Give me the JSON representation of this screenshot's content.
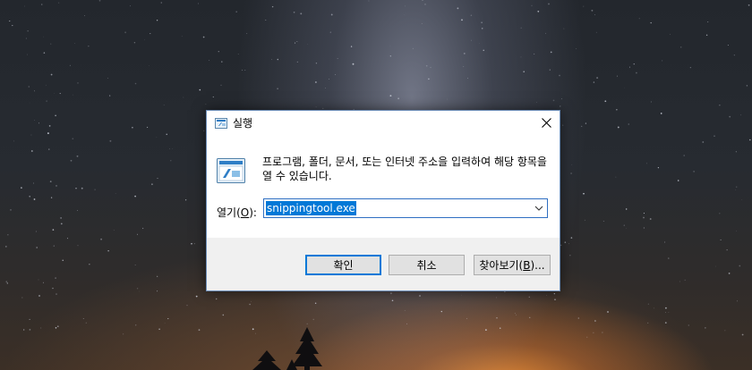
{
  "dialog": {
    "title": "실행",
    "description": "프로그램, 폴더, 문서, 또는 인터넷 주소을 입력하여 해당 항목을 열 수 있습니다.",
    "open_label_prefix": "열기(",
    "open_label_mnemonic": "O",
    "open_label_suffix": "):",
    "command_value": "snippingtool.exe",
    "buttons": {
      "ok": "확인",
      "cancel": "취소",
      "browse_prefix": "찾아보기(",
      "browse_mnemonic": "B",
      "browse_suffix": ")..."
    }
  },
  "colors": {
    "accent": "#0078d7",
    "selection_text": "#ffffff",
    "footer_bg": "#f0f0f0",
    "button_bg": "#e1e1e1"
  },
  "icons": {
    "title_icon": "run-icon",
    "dialog_icon": "run-icon",
    "close_icon": "close-icon",
    "dropdown_icon": "chevron-down-icon"
  }
}
